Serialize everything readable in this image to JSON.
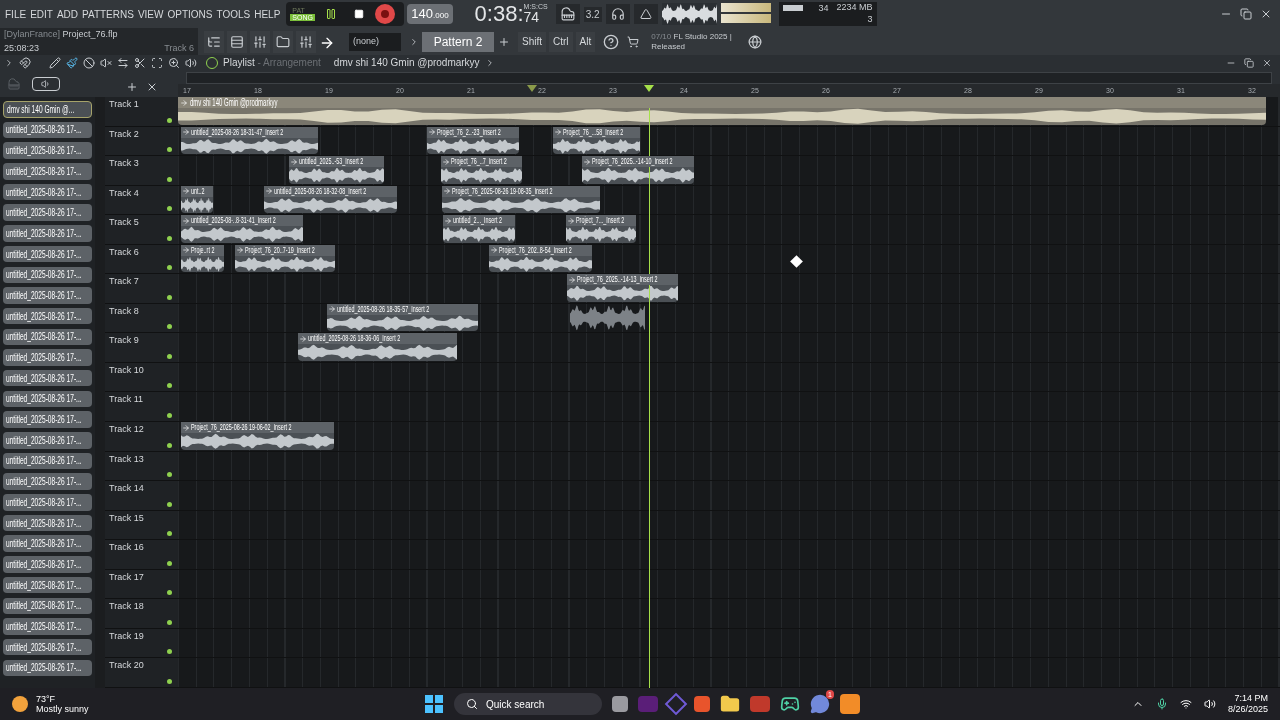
{
  "menu": [
    "FILE",
    "EDIT",
    "ADD",
    "PATTERNS",
    "VIEW",
    "OPTIONS",
    "TOOLS",
    "HELP"
  ],
  "transport": {
    "modes": [
      {
        "label": "PAT",
        "selected": false
      },
      {
        "label": "SONG",
        "selected": true
      }
    ],
    "playing": true,
    "tempo": "140",
    "tempo_decimals": ".000",
    "time": "0:38",
    "time_separator": ":",
    "time_cs": "74",
    "time_unit": "M:S:CS",
    "step": "3.2"
  },
  "monitor": {
    "cpu": "34",
    "memory": "2234 MB",
    "polyphony": "3"
  },
  "project": {
    "user": "[DylanFrance]",
    "file": "Project_76.flp",
    "time": "25:08:23",
    "hint": "Track 6"
  },
  "pattern_bar": {
    "channel": "(none)",
    "pattern": "Pattern 2",
    "keys": [
      "Shift",
      "Ctrl",
      "Alt"
    ],
    "news_date": "07/10",
    "news": "FL Studio 2025 |",
    "news_line2": "Released"
  },
  "playlist": {
    "title": "Playlist",
    "separator": "-",
    "subtitle": "Arrangement",
    "arrangement": "dmv shi 140 Gmin @prodmarkyy"
  },
  "ruler": [
    "17",
    "18",
    "19",
    "20",
    "21",
    "22",
    "23",
    "24",
    "25",
    "26",
    "27",
    "28",
    "29",
    "30",
    "31",
    "32"
  ],
  "picker": [
    {
      "label": "dmv shi 140 Gmin @...",
      "selected": true
    },
    {
      "label": "untitled_2025-08-26 17-...",
      "selected": false
    },
    {
      "label": "untitled_2025-08-26 17-...",
      "selected": false
    },
    {
      "label": "untitled_2025-08-26 17-...",
      "selected": false
    },
    {
      "label": "untitled_2025-08-26 17-...",
      "selected": false
    },
    {
      "label": "untitled_2025-08-26 17-...",
      "selected": false
    },
    {
      "label": "untitled_2025-08-26 17-...",
      "selected": false
    },
    {
      "label": "untitled_2025-08-26 17-...",
      "selected": false
    },
    {
      "label": "untitled_2025-08-26 17-...",
      "selected": false
    },
    {
      "label": "untitled_2025-08-26 17-...",
      "selected": false
    },
    {
      "label": "untitled_2025-08-26 17-...",
      "selected": false
    },
    {
      "label": "untitled_2025-08-26 17-...",
      "selected": false
    },
    {
      "label": "untitled_2025-08-26 17-...",
      "selected": false
    },
    {
      "label": "untitled_2025-08-26 17-...",
      "selected": false
    },
    {
      "label": "untitled_2025-08-26 17-...",
      "selected": false
    },
    {
      "label": "untitled_2025-08-26 17-...",
      "selected": false
    },
    {
      "label": "untitled_2025-08-26 17-...",
      "selected": false
    },
    {
      "label": "untitled_2025-08-26 17-...",
      "selected": false
    },
    {
      "label": "untitled_2025-08-26 17-...",
      "selected": false
    },
    {
      "label": "untitled_2025-08-26 17-...",
      "selected": false
    },
    {
      "label": "untitled_2025-08-26 17-...",
      "selected": false
    },
    {
      "label": "untitled_2025-08-26 17-...",
      "selected": false
    },
    {
      "label": "untitled_2025-08-26 17-...",
      "selected": false
    },
    {
      "label": "untitled_2025-08-26 17-...",
      "selected": false
    },
    {
      "label": "untitled_2025-08-26 17-...",
      "selected": false
    },
    {
      "label": "untitled_2025-08-26 17-...",
      "selected": false
    },
    {
      "label": "untitled_2025-08-26 17-...",
      "selected": false
    },
    {
      "label": "untitled_2025-08-26 17-...",
      "selected": false
    }
  ],
  "tracks": [
    {
      "name": "Track 1",
      "clips": [
        {
          "kind": "arrangement",
          "title": "dmv shi 140 Gmin @prodmarkyy"
        }
      ]
    },
    {
      "name": "Track 2",
      "clips": [
        {
          "kind": "audio",
          "title": "untitled_2025-08-26 18-31-47_Insert 2"
        },
        {
          "kind": "audio",
          "title": "Project_76_2..-23_Insert 2"
        },
        {
          "kind": "audio",
          "title": "Project_76_...58_Insert 2"
        }
      ]
    },
    {
      "name": "Track 3",
      "clips": [
        {
          "kind": "audio",
          "title": "untitled_2025..-53_Insert 2"
        },
        {
          "kind": "audio",
          "title": "Project_76_..7_Insert 2"
        },
        {
          "kind": "audio",
          "title": "Project_76_2025..-14-10_Insert 2"
        }
      ]
    },
    {
      "name": "Track 4",
      "clips": [
        {
          "kind": "audio",
          "title": "unt..2"
        },
        {
          "kind": "audio",
          "title": "untitled_2025-08-26 18-32-08_Insert 2"
        },
        {
          "kind": "audio",
          "title": "Project_76_2025-08-26 19-08-35_Insert 2"
        }
      ]
    },
    {
      "name": "Track 5",
      "clips": [
        {
          "kind": "audio",
          "title": "untitled_2025-08-..8-31-41_Insert 2"
        },
        {
          "kind": "audio",
          "title": "untitled_2..._Insert 2"
        },
        {
          "kind": "audio",
          "title": "Project_7..._Insert 2"
        }
      ]
    },
    {
      "name": "Track 6",
      "clips": [
        {
          "kind": "audio",
          "title": "Proje..rt 2"
        },
        {
          "kind": "audio",
          "title": "Project_76_20..7-19_Insert 2"
        },
        {
          "kind": "audio",
          "title": "Project_76_202..8-54_Insert 2"
        }
      ]
    },
    {
      "name": "Track 7",
      "clips": [
        {
          "kind": "audio",
          "title": "Project_76_2025..-14-13_Insert 2"
        }
      ]
    },
    {
      "name": "Track 8",
      "clips": [
        {
          "kind": "audio",
          "title": "untitled_2025-08-26 18-35-57_Insert 2"
        },
        {
          "kind": "recording"
        }
      ]
    },
    {
      "name": "Track 9",
      "clips": [
        {
          "kind": "audio",
          "title": "untitled_2025-08-26 18-36-06_Insert 2"
        }
      ]
    },
    {
      "name": "Track 10"
    },
    {
      "name": "Track 11"
    },
    {
      "name": "Track 12",
      "clips": [
        {
          "kind": "audio",
          "title": "Project_76_2025-08-26 19-06-02_Insert 2"
        }
      ]
    },
    {
      "name": "Track 13"
    },
    {
      "name": "Track 14"
    },
    {
      "name": "Track 15"
    },
    {
      "name": "Track 16"
    },
    {
      "name": "Track 17"
    },
    {
      "name": "Track 18"
    },
    {
      "name": "Track 19"
    },
    {
      "name": "Track 20"
    }
  ],
  "taskbar": {
    "temperature": "73°F",
    "weather": "Mostly sunny",
    "search": "Quick search",
    "badge": "1",
    "time": "7:14 PM",
    "date": "8/26/2025"
  }
}
